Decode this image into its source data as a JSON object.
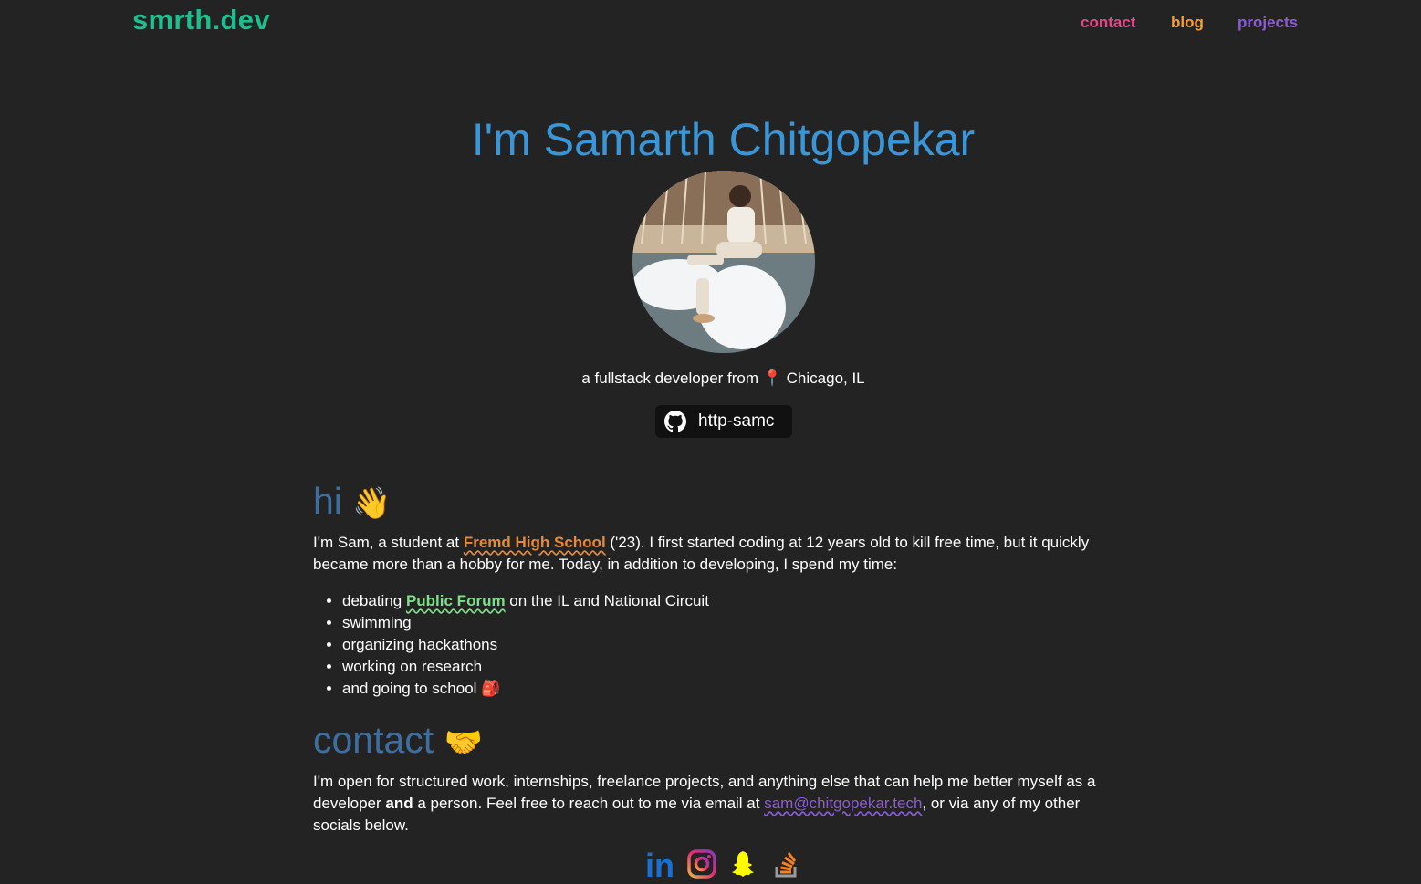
{
  "header": {
    "brand": "smrth.dev",
    "nav": {
      "contact": "contact",
      "blog": "blog",
      "projects": "projects"
    }
  },
  "hero": {
    "title": "I'm Samarth Chitgopekar",
    "tagline_prefix": "a fullstack developer from ",
    "tagline_pin": "📍",
    "tagline_location": " Chicago, IL",
    "github_handle": "http-samc"
  },
  "about": {
    "heading": "hi",
    "heading_emoji": "👋",
    "p1_before": "I'm Sam, a student at ",
    "school": "Fremd High School",
    "p1_after": " ('23). I first started coding at 12 years old to kill free time, but it quickly became more than a hobby for me. Today, in addition to developing, I spend my time:",
    "list": {
      "debate_before": "debating ",
      "debate_link": "Public Forum",
      "debate_after": " on the IL and National Circuit",
      "item2": "swimming",
      "item3": "organizing hackathons",
      "item4": "working on research",
      "item5": "and going to school",
      "item5_emoji": "🎒"
    }
  },
  "contact": {
    "heading": "contact",
    "heading_emoji": "🤝",
    "p_before": "I'm open for structured work, internships, freelance projects, and anything else that can help me better myself as a developer ",
    "p_bold": "and",
    "p_mid": " a person. Feel free to reach out to me via email at ",
    "email": "sam@chitgopekar.tech",
    "p_after": ", or via any of my other socials below."
  },
  "socials": {
    "icons": [
      "linkedin-icon",
      "instagram-icon",
      "snapchat-icon",
      "stackoverflow-icon"
    ],
    "linkedin_text": "in"
  },
  "colors": {
    "brand": "#1fbe8e",
    "title": "#3a96d6",
    "heading": "#3d6e9f",
    "contact_nav": "#e8468a",
    "blog_nav": "#f0a13a",
    "projects_nav": "#8b5cd6",
    "background": "#232323"
  }
}
